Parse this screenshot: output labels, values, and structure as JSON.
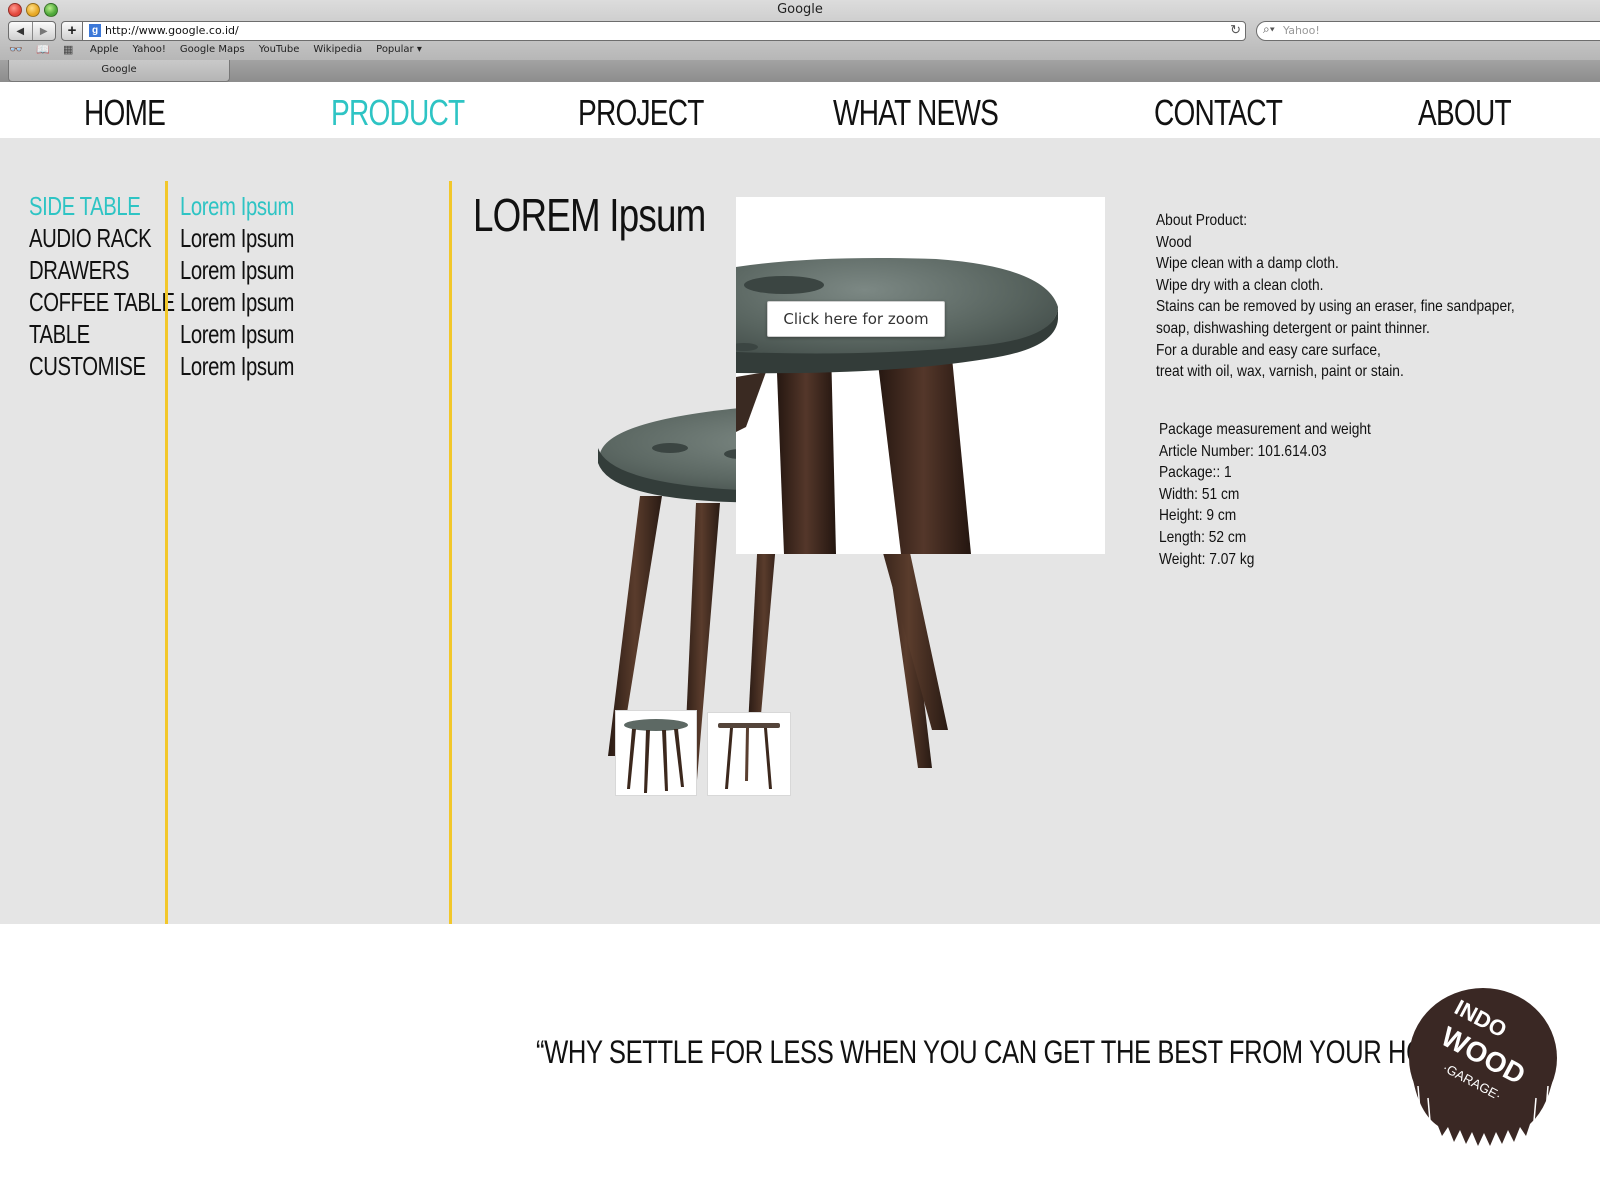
{
  "browser": {
    "window_title": "Google",
    "url": "http://www.google.co.id/",
    "search_placeholder": "Yahoo!",
    "bookmarks": [
      "Apple",
      "Yahoo!",
      "Google Maps",
      "YouTube",
      "Wikipedia",
      "Popular ▾"
    ],
    "tab_title": "Google"
  },
  "nav": {
    "items": [
      "HOME",
      "PRODUCT",
      "PROJECT",
      "WHAT NEWS",
      "CONTACT",
      "ABOUT"
    ],
    "active": "PRODUCT",
    "accent_color": "#2ec4c4"
  },
  "categories": [
    "SIDE TABLE",
    "AUDIO RACK",
    "DRAWERS",
    "COFFEE TABLE",
    "TABLE",
    "CUSTOMISE"
  ],
  "subitems": [
    "Lorem Ipsum",
    "Lorem Ipsum",
    "Lorem Ipsum",
    "Lorem Ipsum",
    "Lorem Ipsum",
    "Lorem Ipsum"
  ],
  "product": {
    "title": "LOREM Ipsum",
    "zoom_hint": "Click here for zoom",
    "about": [
      "About Product:",
      "Wood",
      "Wipe clean with a damp cloth.",
      "Wipe dry with a clean cloth.",
      "Stains can be removed by using an eraser, fine sandpaper,",
      "soap, dishwashing detergent or paint thinner.",
      "For a durable and easy care surface,",
      "treat with oil, wax, varnish, paint or stain."
    ],
    "package": [
      "Package measurement and weight",
      "Article Number: 101.614.03",
      "Package:: 1",
      "Width: 51 cm",
      "Height: 9 cm",
      "Length: 52 cm",
      "Weight: 7.07 kg"
    ]
  },
  "footer": {
    "slogan": "“WHY SETTLE FOR LESS WHEN YOU CAN GET THE BEST FROM YOUR HOMELAND”",
    "logo": {
      "line1": "INDO",
      "line2": "WOOD",
      "line3": "·GARAGE·"
    }
  },
  "colors": {
    "accent": "#2ec4c4",
    "divider": "#f2c72a",
    "content_bg": "#e5e5e5"
  }
}
